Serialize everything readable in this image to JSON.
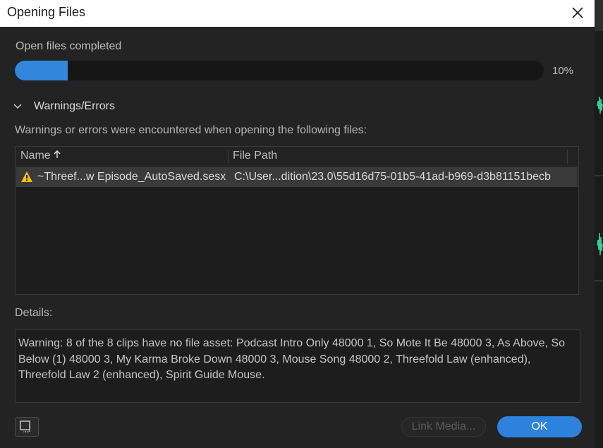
{
  "window": {
    "title": "Opening Files"
  },
  "progress": {
    "label": "Open files completed",
    "percent_text": "10%",
    "fraction": 0.1
  },
  "warnings": {
    "section_title": "Warnings/Errors",
    "description": "Warnings or errors were encountered when opening the following files:",
    "columns": [
      "Name",
      "File Path"
    ],
    "rows": [
      {
        "name": "~Threef...w Episode_AutoSaved.sesx",
        "path": "C:\\User...dition\\23.0\\55d16d75-01b5-41ad-b969-d3b81151becb",
        "icon": "warning-icon"
      }
    ]
  },
  "details": {
    "label": "Details:",
    "text": "Warning: 8 of the 8 clips have no file asset: Podcast Intro Only 48000 1, So Mote It Be 48000 3, As Above, So Below (1) 48000 3, My Karma Broke Down 48000 3, Mouse Song 48000 2, Threefold Law (enhanced), Threefold Law 2 (enhanced), Spirit Guide Mouse."
  },
  "buttons": {
    "link_media": "Link Media...",
    "ok": "OK"
  },
  "colors": {
    "accent": "#2d82de",
    "progress": "#3287dc",
    "warning": "#f2c200"
  }
}
